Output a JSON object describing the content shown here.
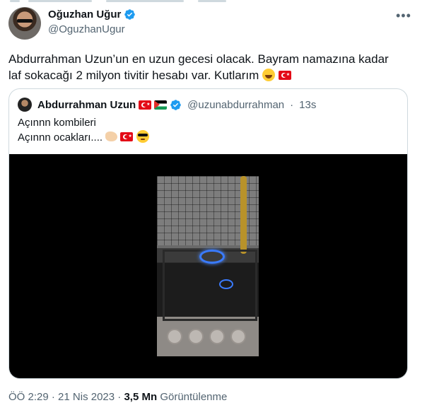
{
  "author": {
    "name": "Oğuzhan Uğur",
    "handle": "@OguzhanUgur",
    "verified": true,
    "more_icon": "more-horizontal-icon"
  },
  "tweet": {
    "text_line1": "Abdurrahman Uzun’un en uzun gecesi olacak. Bayram namazına kadar",
    "text_line2": "laf sokacağı 2 milyon tivitir hesabı var. Kutlarım"
  },
  "quote": {
    "name": "Abdurrahman Uzun",
    "handle": "@uzunabdurrahman",
    "separator": "·",
    "time": "13s",
    "line1": "Açınnn kombileri",
    "line2": "Açınnn ocakları....",
    "media_type": "video"
  },
  "meta": {
    "time": "ÖÖ 2:29",
    "dot1": "·",
    "date": "21 Nis 2023",
    "dot2": "·",
    "views": "3,5 Mn",
    "views_label": "Görüntülenme"
  }
}
